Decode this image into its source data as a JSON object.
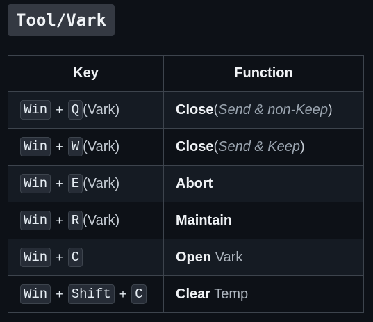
{
  "title": "Tool/Vark",
  "table": {
    "headers": [
      "Key",
      "Function"
    ],
    "rows": [
      {
        "keys": [
          "Win",
          "Q"
        ],
        "suffix": "(Vark)",
        "action": "Close",
        "open_paren": "(",
        "detail": "Send & non-Keep",
        "close_paren": ")",
        "extra": ""
      },
      {
        "keys": [
          "Win",
          "W"
        ],
        "suffix": "(Vark)",
        "action": "Close",
        "open_paren": "(",
        "detail": "Send & Keep",
        "close_paren": ")",
        "extra": ""
      },
      {
        "keys": [
          "Win",
          "E"
        ],
        "suffix": "(Vark)",
        "action": "Abort",
        "open_paren": "",
        "detail": "",
        "close_paren": "",
        "extra": ""
      },
      {
        "keys": [
          "Win",
          "R"
        ],
        "suffix": "(Vark)",
        "action": "Maintain",
        "open_paren": "",
        "detail": "",
        "close_paren": "",
        "extra": ""
      },
      {
        "keys": [
          "Win",
          "C"
        ],
        "suffix": "",
        "action": "Open",
        "open_paren": "",
        "detail": "",
        "close_paren": "",
        "extra": " Vark"
      },
      {
        "keys": [
          "Win",
          "Shift",
          "C"
        ],
        "suffix": "",
        "action": "Clear",
        "open_paren": "",
        "detail": "",
        "close_paren": "",
        "extra": " Temp"
      }
    ]
  }
}
